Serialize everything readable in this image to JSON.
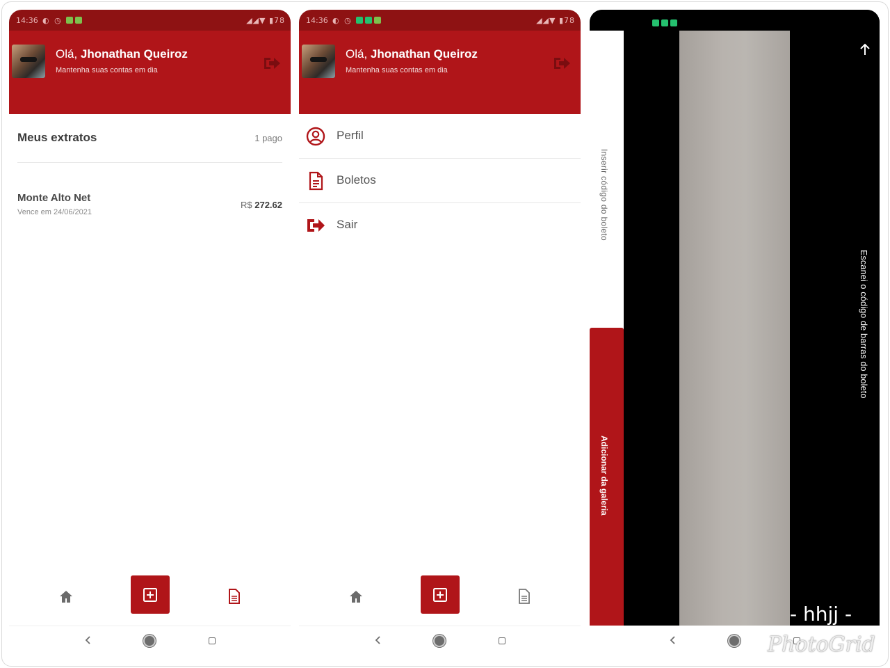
{
  "statusbar": {
    "time": "14:36",
    "battery": "78"
  },
  "header": {
    "greeting_prefix": "Olá, ",
    "user_name": "Jhonathan Queiroz",
    "subtitle": "Mantenha suas contas em dia"
  },
  "extratos": {
    "title": "Meus extratos",
    "count": "1 pago",
    "items": [
      {
        "name": "Monte Alto Net",
        "due": "Vence em 24/06/2021",
        "currency": "R$",
        "amount": "272.62"
      }
    ]
  },
  "menu": {
    "items": [
      {
        "label": "Perfil",
        "icon": "user-circle-icon"
      },
      {
        "label": "Boletos",
        "icon": "document-icon"
      },
      {
        "label": "Sair",
        "icon": "logout-icon"
      }
    ]
  },
  "camera": {
    "insert_code_label": "Inserir código do boleto",
    "gallery_button": "Adicionar da galeria",
    "scan_hint": "Escanei o código de barras do boleto",
    "overlay_text": "- hhjj -",
    "watermark": "PhotoGrid"
  },
  "colors": {
    "primary": "#b01519",
    "statusbar": "#8e1213"
  }
}
